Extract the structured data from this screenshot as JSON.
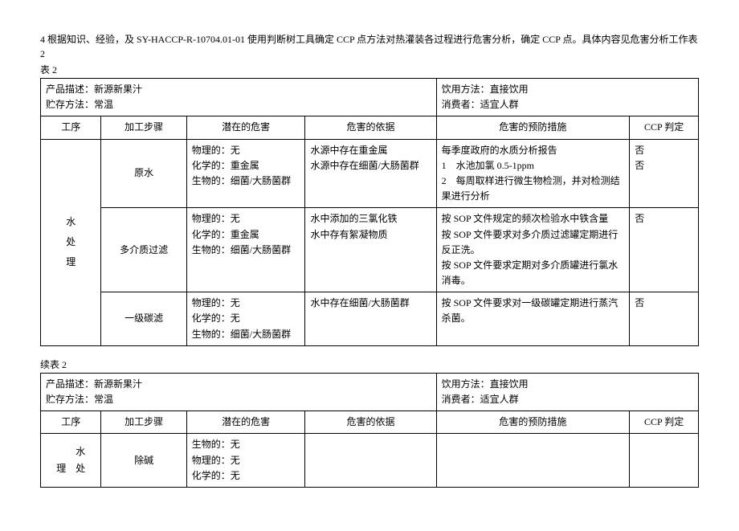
{
  "intro": "4 根据知识、经验，及 SY-HACCP-R-10704.01-01 使用判断树工具确定 CCP 点方法对热灌装各过程进行危害分析，确定 CCP 点。具体内容见危害分析工作表 2",
  "table2_label": "表 2",
  "info": {
    "product_desc_label": "产品描述：",
    "product_desc_value": "新源新果汁",
    "storage_label": "贮存方法：",
    "storage_value": "常温",
    "drink_label": "饮用方法：",
    "drink_value": "直接饮用",
    "consumer_label": "消费者：",
    "consumer_value": "适宜人群"
  },
  "headers": {
    "process": "工序",
    "step": "加工步骤",
    "hazard": "潜在的危害",
    "basis": "危害的依据",
    "prevention": "危害的预防措施",
    "ccp": "CCP 判定"
  },
  "process_name": "水 处 理",
  "table2_rows": [
    {
      "step": "原水",
      "hazard": "物理的：无\n化学的：重金属\n生物的：细菌/大肠菌群",
      "basis": "水源中存在重金属\n水源中存在细菌/大肠菌群",
      "prevention": "每季度政府的水质分析报告\n1　水池加氯 0.5-1ppm\n2　每周取样进行微生物检测，并对检测结果进行分析",
      "ccp": "否\n否"
    },
    {
      "step": "多介质过滤",
      "hazard": "物理的：无\n化学的：重金属\n生物的：细菌/大肠菌群",
      "basis": "水中添加的三氯化铁\n水中存有絮凝物质",
      "prevention": "按 SOP 文件规定的频次检验水中铁含量\n按 SOP 文件要求对多介质过滤罐定期进行反正洗。\n按 SOP 文件要求定期对多介质罐进行氯水消毒。",
      "ccp": "否"
    },
    {
      "step": "一级碳滤",
      "hazard": "物理的：无\n化学的：无\n生物的：细菌/大肠菌群",
      "basis": "水中存在细菌/大肠菌群",
      "prevention": "按 SOP 文件要求对一级碳罐定期进行蒸汽杀菌。",
      "ccp": "否"
    }
  ],
  "cont_label": "续表 2",
  "process_name_2a": "水",
  "process_name_2b": "理　处",
  "table2_cont_rows": [
    {
      "step": "除碱",
      "hazard": "生物的：无\n物理的：无\n化学的：无",
      "basis": "",
      "prevention": "",
      "ccp": ""
    }
  ]
}
